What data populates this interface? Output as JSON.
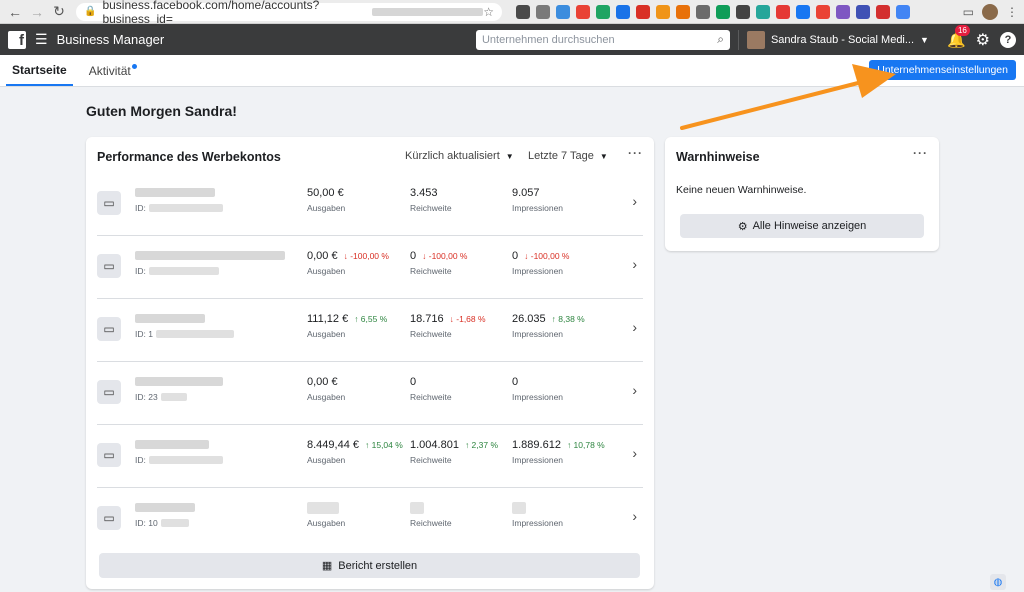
{
  "browser": {
    "url_prefix": "business.facebook.com/home/accounts?business_id=",
    "back_icon": "arrow-left-icon",
    "forward_icon": "arrow-right-icon",
    "reload_icon": "reload-icon",
    "ext_colors": [
      "#4a4a4a",
      "#7a7a7a",
      "#3c8dde",
      "#e94235",
      "#1fa463",
      "#1a73e8",
      "#d93025",
      "#f09418",
      "#e8710a",
      "#6a6a6a",
      "#0f9d58",
      "#444444",
      "#26a69a",
      "#e53935",
      "#1877f2",
      "#ea4335",
      "#7e57c2",
      "#3f51b5",
      "#d32f2f",
      "#4285f4"
    ]
  },
  "header": {
    "logo": "f",
    "title": "Business Manager",
    "search_placeholder": "Unternehmen durchsuchen",
    "user_name": "Sandra Staub - Social Medi...",
    "notification_count": "16"
  },
  "tabs": [
    {
      "label": "Startseite",
      "active": true
    },
    {
      "label": "Aktivität",
      "active": false
    }
  ],
  "settings_button": "Unternehmenseinstellungen",
  "greeting": "Guten Morgen Sandra!",
  "performance": {
    "title": "Performance des Werbekontos",
    "filter_sort": "Kürzlich aktualisiert",
    "filter_range": "Letzte 7 Tage",
    "rows": [
      {
        "id": "ID: ",
        "m1": "50,00 €",
        "d1": "",
        "m2": "3.453",
        "d2": "",
        "m3": "9.057",
        "d3": ""
      },
      {
        "id": "ID: ",
        "m1": "0,00 €",
        "d1": "↓ -100,00 %",
        "m2": "0",
        "d2": "↓ -100,00 %",
        "m3": "0",
        "d3": "↓ -100,00 %"
      },
      {
        "id": "ID: 1",
        "m1": "111,12 €",
        "d1": "↑ 6,55 %",
        "m2": "18.716",
        "d2": "↓ -1,68 %",
        "m3": "26.035",
        "d3": "↑ 8,38 %"
      },
      {
        "id": "ID: 23",
        "m1": "0,00 €",
        "d1": "",
        "m2": "0",
        "d2": "",
        "m3": "0",
        "d3": ""
      },
      {
        "id": "ID: ",
        "m1": "8.449,44 €",
        "d1": "↑ 15,04 %",
        "m2": "1.004.801",
        "d2": "↑ 2,37 %",
        "m3": "1.889.612",
        "d3": "↑ 10,78 %"
      },
      {
        "id": "ID: 10",
        "m1": "",
        "d1": "",
        "m2": "",
        "d2": "",
        "m3": "",
        "d3": ""
      }
    ],
    "label_spend": "Ausgaben",
    "label_reach": "Reichweite",
    "label_impr": "Impressionen",
    "report_button": "Bericht erstellen"
  },
  "warnings": {
    "title": "Warnhinweise",
    "empty_text": "Keine neuen Warnhinweise.",
    "button": "Alle Hinweise anzeigen"
  },
  "colors": {
    "accent": "#1877f2",
    "annotation_arrow": "#f7931e",
    "down": "#d93025",
    "up": "#2e8540"
  }
}
